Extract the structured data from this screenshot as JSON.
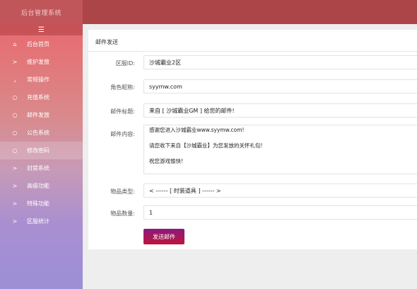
{
  "app": {
    "title": "后台管理系统"
  },
  "sidebar": {
    "toggle_icon": "☰",
    "items": [
      {
        "label": "后台首页",
        "icon": "⌂"
      },
      {
        "label": "维护发放",
        "icon": ">"
      },
      {
        "label": "常规操作",
        "icon": "⌟"
      },
      {
        "label": "充值系统",
        "icon": "○"
      },
      {
        "label": "邮件发放",
        "icon": "○"
      },
      {
        "label": "公告系统",
        "icon": "○"
      },
      {
        "label": "修改密码",
        "icon": "○"
      },
      {
        "label": "封禁系统",
        "icon": ">"
      },
      {
        "label": "高级功能",
        "icon": ">"
      },
      {
        "label": "特殊功能",
        "icon": ">"
      },
      {
        "label": "区服统计",
        "icon": ">"
      }
    ]
  },
  "form": {
    "title": "邮件发送",
    "server": {
      "label": "区服ID:",
      "value": "沙城霸业2区"
    },
    "role": {
      "label": "角色昵称:",
      "value": "syymw.com"
    },
    "subject": {
      "label": "邮件标题:",
      "value": "来自 [ 沙城霸业GM ] 给您的邮件!"
    },
    "content": {
      "label": "邮件内容:",
      "lines": [
        "感谢您进入沙城霸业www.syymw.com!",
        "请您收下来自【沙城霸业】为您发放的关怀礼包!",
        "祝您游戏愉快!"
      ]
    },
    "item_type": {
      "label": "物品类型:",
      "value": "< ------ [ 时装道具 ] ------ >"
    },
    "item_qty": {
      "label": "物品数量:",
      "value": "1"
    },
    "submit_label": "发送邮件"
  }
}
